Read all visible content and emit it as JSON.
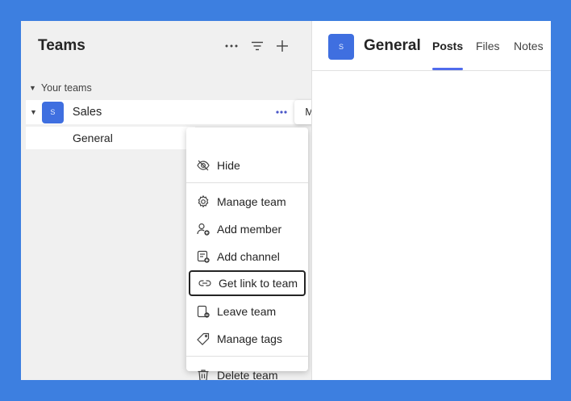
{
  "left_pane": {
    "title": "Teams",
    "section_label": "Your teams",
    "team": {
      "name": "Sales",
      "avatar_letter": "S"
    },
    "channel": {
      "name": "General"
    }
  },
  "tooltip": {
    "text": "More options"
  },
  "context_menu": {
    "items": [
      {
        "label": "Hide",
        "icon": "eye-off-icon"
      },
      {
        "label": "Manage team",
        "icon": "gear-icon"
      },
      {
        "label": "Add member",
        "icon": "add-person-icon"
      },
      {
        "label": "Add channel",
        "icon": "add-channel-icon"
      },
      {
        "label": "Get link to team",
        "icon": "link-icon",
        "focused": true
      },
      {
        "label": "Leave team",
        "icon": "leave-icon"
      },
      {
        "label": "Manage tags",
        "icon": "tag-icon"
      },
      {
        "label": "Delete team",
        "icon": "trash-icon"
      }
    ]
  },
  "channel_header": {
    "avatar_letter": "S",
    "title": "General",
    "tabs": [
      {
        "label": "Posts",
        "active": true
      },
      {
        "label": "Files",
        "active": false
      },
      {
        "label": "Notes",
        "active": false
      }
    ]
  },
  "colors": {
    "background": "#3d7fe0",
    "accent": "#4f6bed",
    "avatar": "#3f6fe0"
  }
}
